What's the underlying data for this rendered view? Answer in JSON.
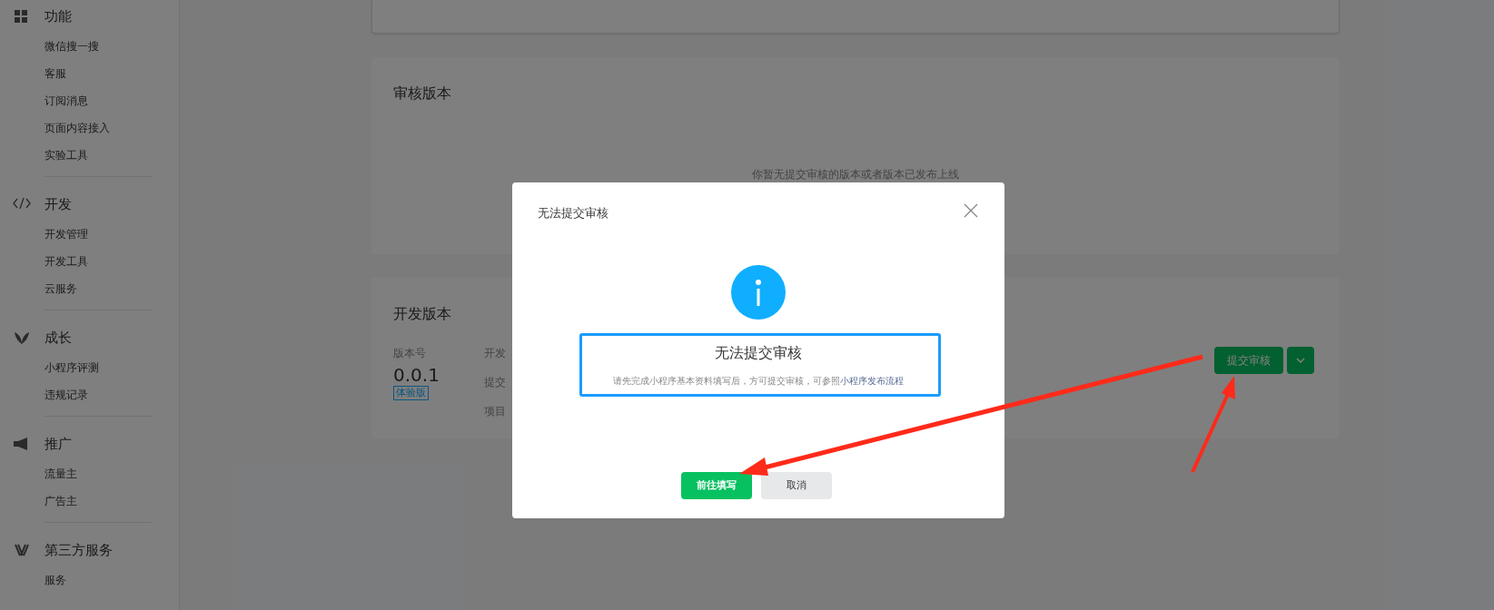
{
  "sidebar": {
    "groups": [
      {
        "title": "功能",
        "items": [
          "微信搜一搜",
          "客服",
          "订阅消息",
          "页面内容接入",
          "实验工具"
        ]
      },
      {
        "title": "开发",
        "items": [
          "开发管理",
          "开发工具",
          "云服务"
        ]
      },
      {
        "title": "成长",
        "items": [
          "小程序评测",
          "违规记录"
        ]
      },
      {
        "title": "推广",
        "items": [
          "流量主",
          "广告主"
        ]
      },
      {
        "title": "第三方服务",
        "items": [
          "服务"
        ]
      }
    ]
  },
  "audit_card": {
    "title": "审核版本",
    "empty_text": "你暂无提交审核的版本或者版本已发布上线"
  },
  "dev_card": {
    "title": "开发版本",
    "version_label": "版本号",
    "version": "0.0.1",
    "badge": "体验版",
    "column_labels": [
      "开发",
      "提交",
      "项目"
    ],
    "submit_button": "提交审核"
  },
  "dialog": {
    "title": "无法提交审核",
    "heading": "无法提交审核",
    "message": "请先完成小程序基本资料填写后，方可提交审核，可参照",
    "link": "小程序发布流程",
    "confirm_button": "前往填写",
    "cancel_button": "取消"
  }
}
